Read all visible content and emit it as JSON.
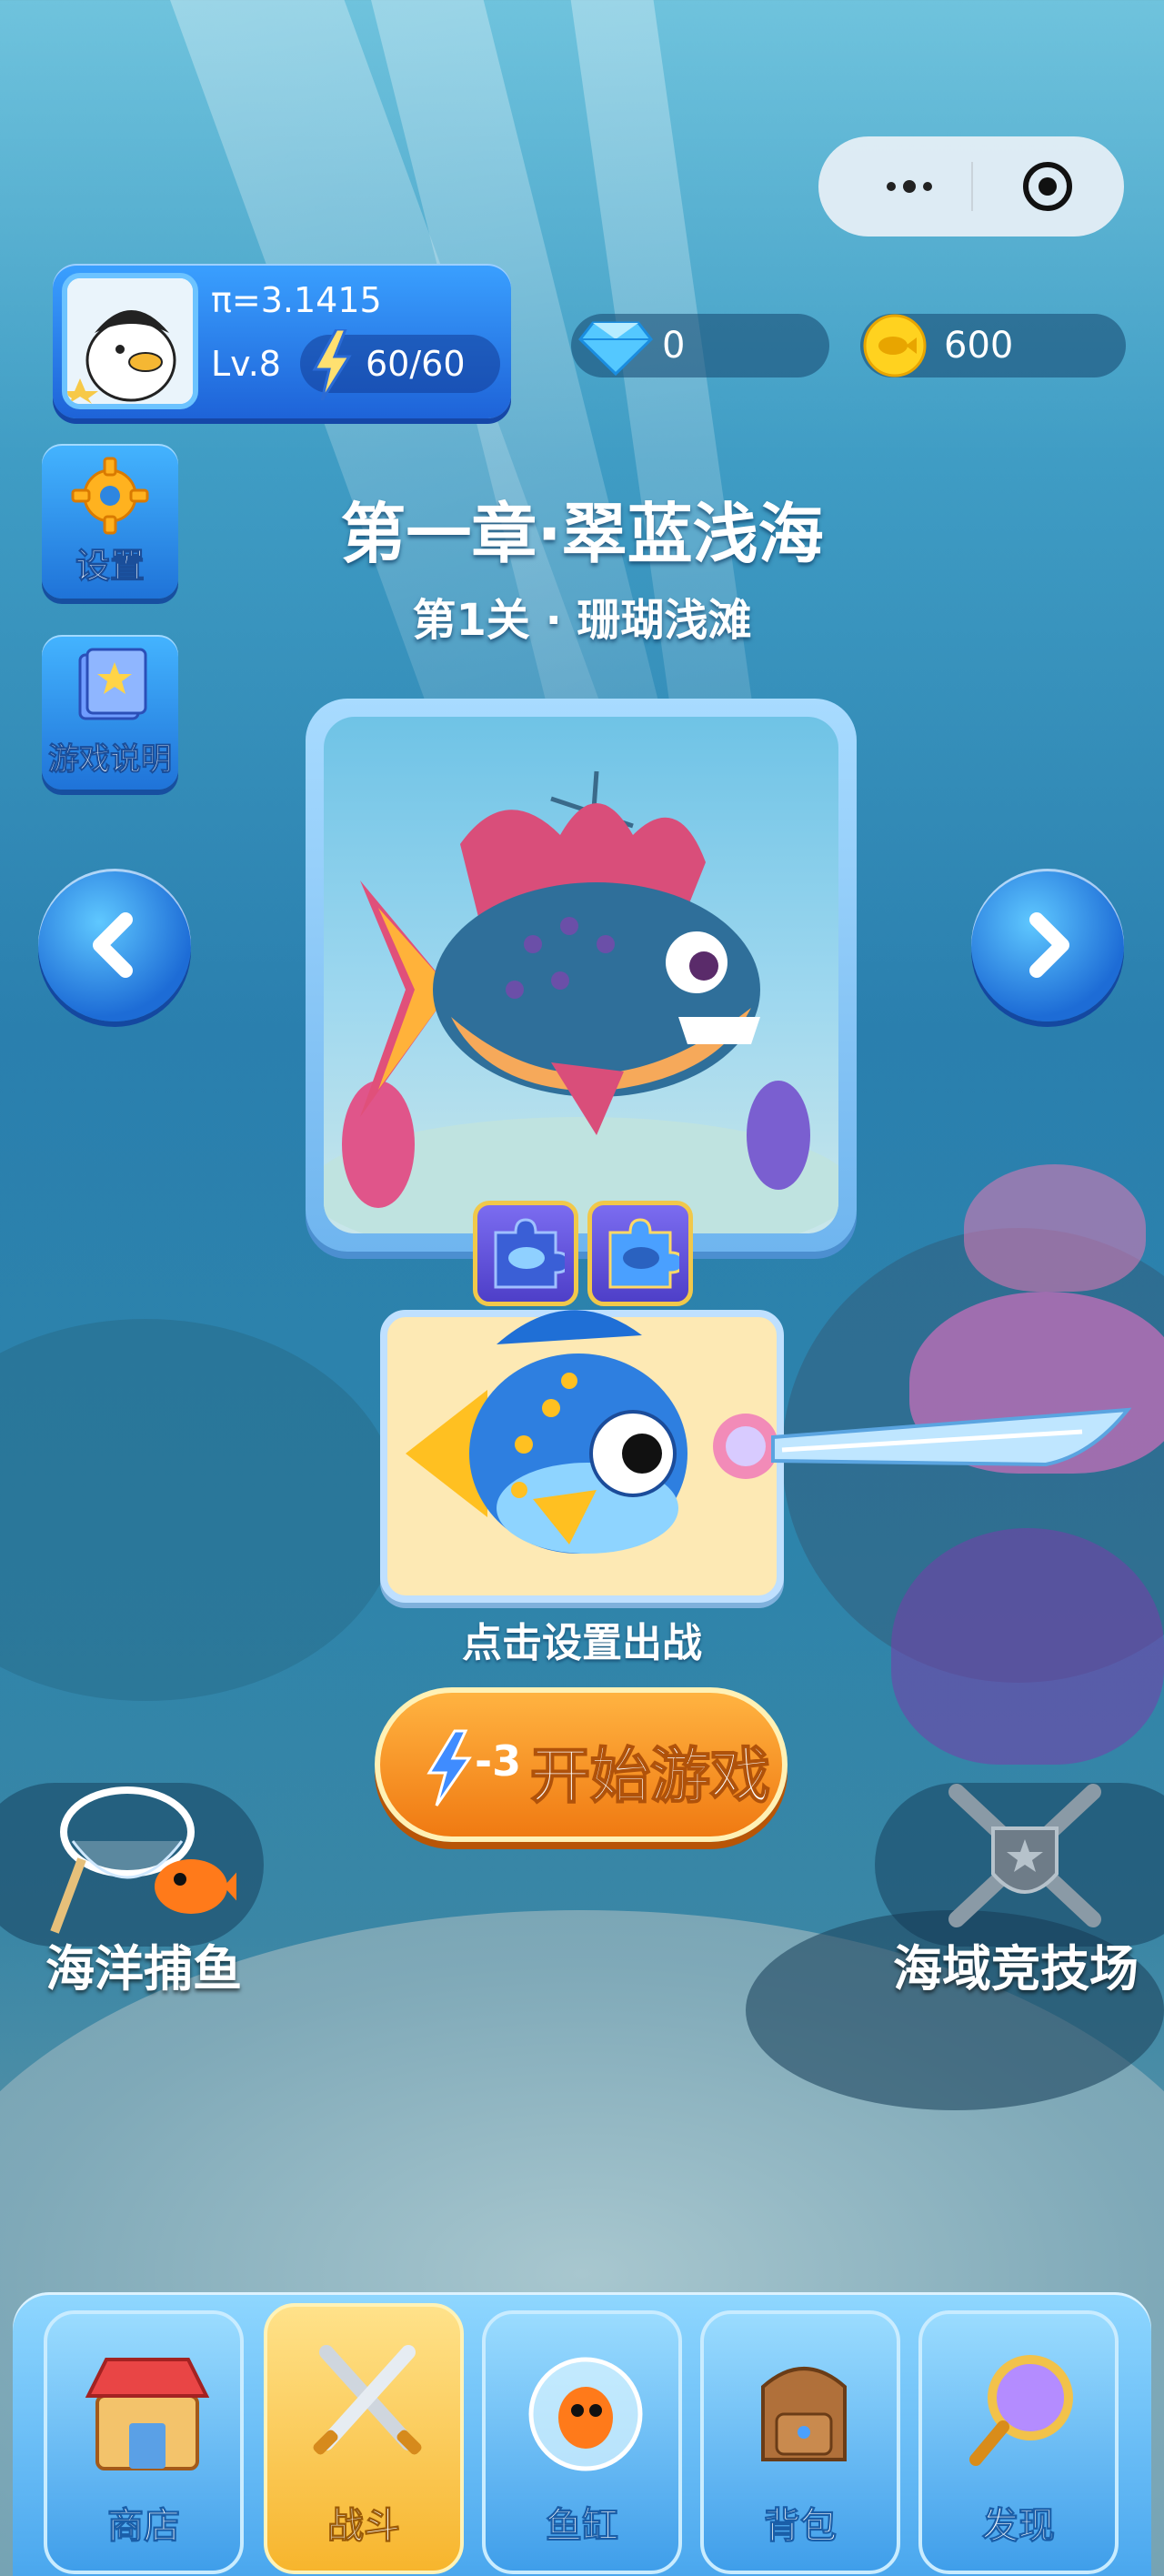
{
  "player": {
    "name": "π=3.1415",
    "level": "Lv.8",
    "energy": "60/60"
  },
  "resources": {
    "diamonds": "0",
    "coins": "600"
  },
  "side_buttons": {
    "settings": "设置",
    "guide": "游戏说明"
  },
  "stage": {
    "chapter": "第一章·翠蓝浅海",
    "level": "第1关 · 珊瑚浅滩"
  },
  "battle": {
    "hint": "点击设置出战",
    "cost": "-3",
    "start_label": "开始游戏"
  },
  "modes": {
    "fishing": "海洋捕鱼",
    "arena": "海域竞技场"
  },
  "nav": {
    "items": [
      {
        "label": "商店",
        "icon": "shop-icon"
      },
      {
        "label": "战斗",
        "icon": "swords-icon"
      },
      {
        "label": "鱼缸",
        "icon": "fishbowl-icon"
      },
      {
        "label": "背包",
        "icon": "backpack-icon"
      },
      {
        "label": "发现",
        "icon": "magnifier-icon"
      }
    ],
    "active": "战斗"
  },
  "colors": {
    "accent_blue": "#1e63d8",
    "start_orange": "#f07a12",
    "nav_active": "#f7b52d"
  }
}
